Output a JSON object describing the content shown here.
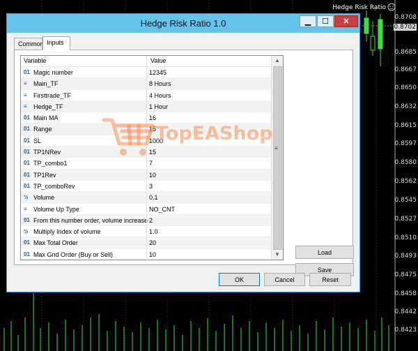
{
  "chart": {
    "symbol_title": "Hedge Risk Ratio",
    "prices": [
      "0.8708",
      "0.8702",
      "0.8685",
      "0.8667",
      "0.8650",
      "0.8632",
      "0.8615",
      "0.8597",
      "0.8580",
      "0.8562",
      "0.8545",
      "0.8527",
      "0.8510",
      "0.8493",
      "0.8475",
      "0.8458",
      "0.8442",
      "0.8423"
    ],
    "highlight_price": "0.8702"
  },
  "dialog": {
    "title": "Hedge Risk Ratio 1.0",
    "min_label": "▁",
    "max_label": "☐",
    "close_label": "✕",
    "tabs": [
      {
        "label": "Common"
      },
      {
        "label": "Inputs"
      }
    ],
    "table": {
      "headers": {
        "variable": "Variable",
        "value": "Value"
      },
      "rows": [
        {
          "icon": "01",
          "name": "Magic number",
          "value": "12345"
        },
        {
          "icon": "≡",
          "name": "Main_TF",
          "value": "8 Hours"
        },
        {
          "icon": "≡",
          "name": "Firsttrade_TF",
          "value": "4 Hours"
        },
        {
          "icon": "≡",
          "name": "Hedge_TF",
          "value": "1 Hour"
        },
        {
          "icon": "01",
          "name": "Main MA",
          "value": "16"
        },
        {
          "icon": "01",
          "name": "Range",
          "value": "15"
        },
        {
          "icon": "01",
          "name": "SL",
          "value": "1000"
        },
        {
          "icon": "01",
          "name": "TP1NRev",
          "value": "15"
        },
        {
          "icon": "01",
          "name": "TP_combo1",
          "value": "7"
        },
        {
          "icon": "01",
          "name": "TP1Rev",
          "value": "10"
        },
        {
          "icon": "01",
          "name": "TP_comboRev",
          "value": "3"
        },
        {
          "icon": "½",
          "name": "Volume",
          "value": "0.1"
        },
        {
          "icon": "≡",
          "name": "Volume Up Type",
          "value": "NO_CNT"
        },
        {
          "icon": "01",
          "name": "From this number order, volume increase",
          "value": "2"
        },
        {
          "icon": "½",
          "name": "Multiply Index of volume",
          "value": "1.0"
        },
        {
          "icon": "01",
          "name": "Max Total Order",
          "value": "20"
        },
        {
          "icon": "01",
          "name": "Max Grid Order (Buy or Sell)",
          "value": "10"
        }
      ]
    },
    "buttons": {
      "load": "Load",
      "save": "Save",
      "ok": "OK",
      "cancel": "Cancel",
      "reset": "Reset"
    }
  },
  "watermark": {
    "text": "TopEAShop"
  }
}
